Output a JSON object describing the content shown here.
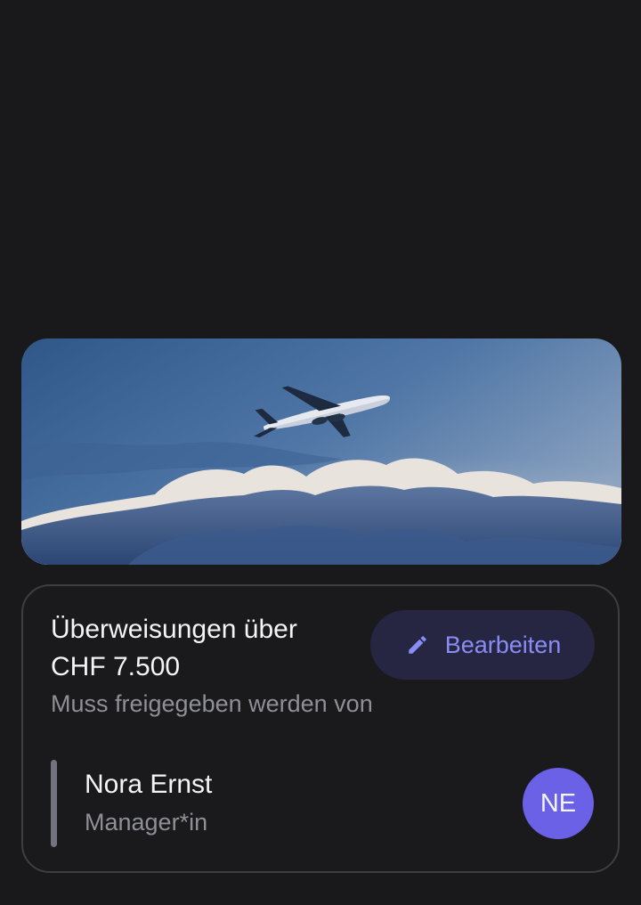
{
  "hero": {
    "image": "airplane-in-cloudy-sky-photo"
  },
  "card": {
    "title": "Überweisungen über CHF 7.500",
    "subtitle": "Muss freigegeben werden von",
    "edit_button": {
      "label": "Bearbeiten",
      "icon": "pencil-icon"
    },
    "approver": {
      "name": "Nora Ernst",
      "role": "Manager*in",
      "initials": "NE",
      "avatar_color": "#6a61e6"
    }
  },
  "colors": {
    "background": "#19191b",
    "accent": "#8a8cf5",
    "button_bg": "#262642"
  }
}
